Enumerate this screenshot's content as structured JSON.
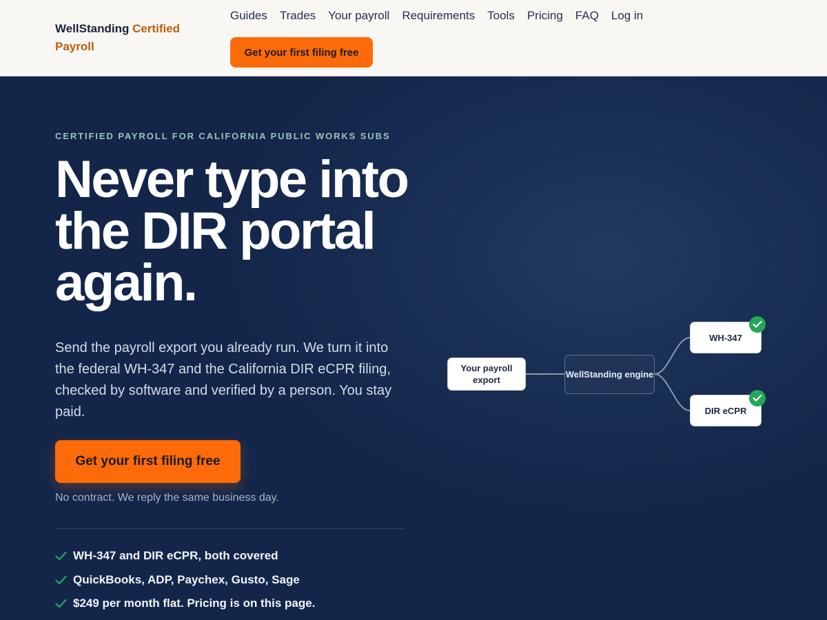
{
  "header": {
    "logo_main": "WellStanding",
    "logo_accent": "Certified Payroll",
    "nav": [
      "Guides",
      "Trades",
      "Your payroll",
      "Requirements",
      "Tools",
      "Pricing",
      "FAQ",
      "Log in"
    ],
    "cta": "Get your first filing free"
  },
  "hero": {
    "eyebrow": "CERTIFIED PAYROLL FOR CALIFORNIA PUBLIC WORKS SUBS",
    "headline": "Never type into the DIR portal again.",
    "subcopy": "Send the payroll export you already run. We turn it into the federal WH-347 and the California DIR eCPR filing, checked by software and verified by a person. You stay paid.",
    "cta": "Get your first filing free",
    "note": "No contract. We reply the same business day.",
    "bullets": [
      "WH-347 and DIR eCPR, both covered",
      "QuickBooks, ADP, Paychex, Gusto, Sage",
      "$249 per month flat. Pricing is on this page."
    ]
  },
  "diagram": {
    "source": "Your payroll export",
    "engine": "WellStanding engine",
    "outputs": [
      "WH-347",
      "DIR eCPR"
    ]
  },
  "colors": {
    "accent": "#fd6a0a",
    "navy": "#13264a",
    "logo_accent": "#c15b0c",
    "check": "#24a657"
  },
  "icons": {
    "bullet": "check-icon",
    "badge": "check-circle-icon"
  }
}
